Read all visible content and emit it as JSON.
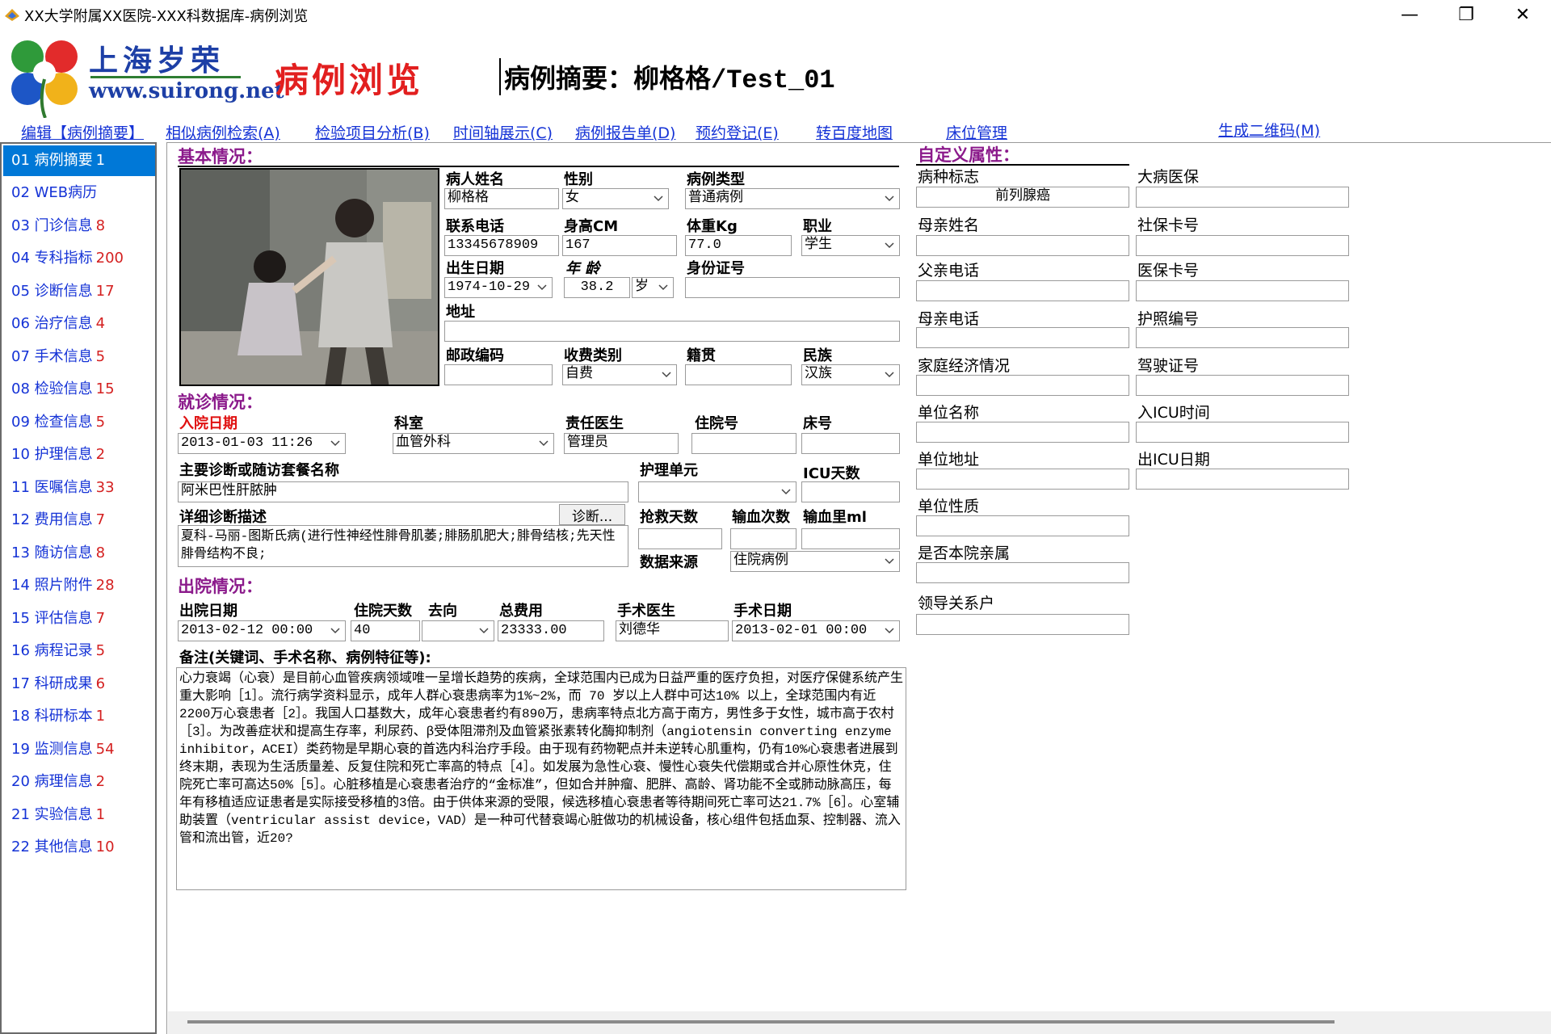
{
  "window": {
    "title": "XX大学附属XX医院-XXX科数据库-病例浏览",
    "min": "—",
    "max": "❐",
    "close": "✕"
  },
  "header": {
    "logo_cn": "上海岁荣",
    "logo_url": "www.suirong.net",
    "page_title": "病例浏览",
    "summary": "病例摘要：柳格格/Test_01"
  },
  "menu": [
    "编辑【病例摘要】",
    "相似病例检索(A)",
    "检验项目分析(B)",
    "时间轴展示(C)",
    "病例报告单(D)",
    "预约登记(E)",
    "转百度地图",
    "床位管理",
    "生成二维码(M)"
  ],
  "sidebar": [
    {
      "label": "01 病例摘要",
      "count": "1"
    },
    {
      "label": "02 WEB病历",
      "count": ""
    },
    {
      "label": "03 门诊信息",
      "count": "8"
    },
    {
      "label": "04 专科指标",
      "count": "200"
    },
    {
      "label": "05 诊断信息",
      "count": "17"
    },
    {
      "label": "06 治疗信息",
      "count": "4"
    },
    {
      "label": "07 手术信息",
      "count": "5"
    },
    {
      "label": "08 检验信息",
      "count": "15"
    },
    {
      "label": "09 检查信息",
      "count": "5"
    },
    {
      "label": "10 护理信息",
      "count": "2"
    },
    {
      "label": "11 医嘱信息",
      "count": "33"
    },
    {
      "label": "12 费用信息",
      "count": "7"
    },
    {
      "label": "13 随访信息",
      "count": "8"
    },
    {
      "label": "14 照片附件",
      "count": "28"
    },
    {
      "label": "15 评估信息",
      "count": "7"
    },
    {
      "label": "16 病程记录",
      "count": "5"
    },
    {
      "label": "17 科研成果",
      "count": "6"
    },
    {
      "label": "18 科研标本",
      "count": "1"
    },
    {
      "label": "19 监测信息",
      "count": "54"
    },
    {
      "label": "20 病理信息",
      "count": "2"
    },
    {
      "label": "21 实验信息",
      "count": "1"
    },
    {
      "label": "22 其他信息",
      "count": "10"
    }
  ],
  "basic": {
    "heading": "基本情况：",
    "name_label": "病人姓名",
    "name": "柳格格",
    "sex_label": "性别",
    "sex": "女",
    "type_label": "病例类型",
    "type": "普通病例",
    "phone_label": "联系电话",
    "phone": "13345678909",
    "height_label": "身高CM",
    "height": "167",
    "weight_label": "体重Kg",
    "weight": "77.0",
    "job_label": "职业",
    "job": "学生",
    "birth_label": "出生日期",
    "birth": "1974-10-29",
    "age_label": "年 龄",
    "age": "38.2",
    "age_unit": "岁",
    "id_label": "身份证号",
    "id": "",
    "addr_label": "地址",
    "addr": "",
    "zip_label": "邮政编码",
    "zip": "",
    "fee_label": "收费类别",
    "fee": "自费",
    "native_label": "籍贯",
    "native": "",
    "ethnic_label": "民族",
    "ethnic": "汉族"
  },
  "visit": {
    "heading": "就诊情况：",
    "admit_label": "入院日期",
    "admit": "2013-01-03 11:26",
    "dept_label": "科室",
    "dept": "血管外科",
    "doctor_label": "责任医生",
    "doctor": "管理员",
    "inpatient_label": "住院号",
    "inpatient": "",
    "bed_label": "床号",
    "bed": "",
    "diag_label": "主要诊断或随访套餐名称",
    "diag": "阿米巴性肝脓肿",
    "nursing_label": "护理单元",
    "nursing": "",
    "icu_label": "ICU天数",
    "icu": "",
    "detail_label": "详细诊断描述",
    "diag_btn": "诊断...",
    "detail": "夏科-马丽-图斯氏病(进行性神经性腓骨肌萎;腓肠肌肥大;腓骨结核;先天性腓骨结构不良;",
    "rescue_label": "抢救天数",
    "rescue": "",
    "transfusion_count_label": "输血次数",
    "transfusion_count": "",
    "transfusion_vol_label": "输血里ml",
    "transfusion_vol": "",
    "source_label": "数据来源",
    "source": "住院病例"
  },
  "discharge": {
    "heading": "出院情况：",
    "date_label": "出院日期",
    "date": "2013-02-12 00:00",
    "days_label": "住院天数",
    "days": "40",
    "dest_label": "去向",
    "dest": "",
    "cost_label": "总费用",
    "cost": "23333.00",
    "surgeon_label": "手术医生",
    "surgeon": "刘德华",
    "surgery_date_label": "手术日期",
    "surgery_date": "2013-02-01 00:00",
    "notes_label": "备注(关键词、手术名称、病例特征等):",
    "notes": "心力衰竭（心衰）是目前心血管疾病领域唯一呈增长趋势的疾病，全球范围内已成为日益严重的医疗负担，对医疗保健系统产生重大影响［1］。流行病学资料显示，成年人群心衰患病率为1%~2%，而 70 岁以上人群中可达10% 以上，全球范围内有近2200万心衰患者［2］。我国人口基数大，成年心衰患者约有890万，患病率特点北方高于南方，男性多于女性，城市高于农村［3］。为改善症状和提高生存率，利尿药、β受体阻滞剂及血管紧张素转化酶抑制剂（angiotensin converting enzyme inhibitor，ACEI）类药物是早期心衰的首选内科治疗手段。由于现有药物靶点并未逆转心肌重构，仍有10%心衰患者进展到终末期，表现为生活质量差、反复住院和死亡率高的特点［4］。如发展为急性心衰、慢性心衰失代偿期或合并心原性休克，住院死亡率可高达50%［5］。心脏移植是心衰患者治疗的“金标准”，但如合并肿瘤、肥胖、高龄、肾功能不全或肺动脉高压，每年有移植适应证患者是实际接受移植的3倍。由于供体来源的受限，候选移植心衰患者等待期间死亡率可达21.7%［6］。心室辅助装置（ventricular assist device，VAD）是一种可代替衰竭心脏做功的机械设备，核心组件包括血泵、控制器、流入管和流出管，近20?"
  },
  "custom": {
    "heading": "自定义属性：",
    "left": [
      {
        "label": "病种标志",
        "value": "前列腺癌"
      },
      {
        "label": "母亲姓名",
        "value": ""
      },
      {
        "label": "父亲电话",
        "value": ""
      },
      {
        "label": "母亲电话",
        "value": ""
      },
      {
        "label": "家庭经济情况",
        "value": ""
      },
      {
        "label": "单位名称",
        "value": ""
      },
      {
        "label": "单位地址",
        "value": ""
      },
      {
        "label": "单位性质",
        "value": ""
      },
      {
        "label": "是否本院亲属",
        "value": ""
      },
      {
        "label": "领导关系户",
        "value": ""
      }
    ],
    "right": [
      {
        "label": "大病医保",
        "value": ""
      },
      {
        "label": "社保卡号",
        "value": ""
      },
      {
        "label": "医保卡号",
        "value": ""
      },
      {
        "label": "护照编号",
        "value": ""
      },
      {
        "label": "驾驶证号",
        "value": ""
      },
      {
        "label": "入ICU时间",
        "value": ""
      },
      {
        "label": "出ICU日期",
        "value": ""
      }
    ]
  }
}
